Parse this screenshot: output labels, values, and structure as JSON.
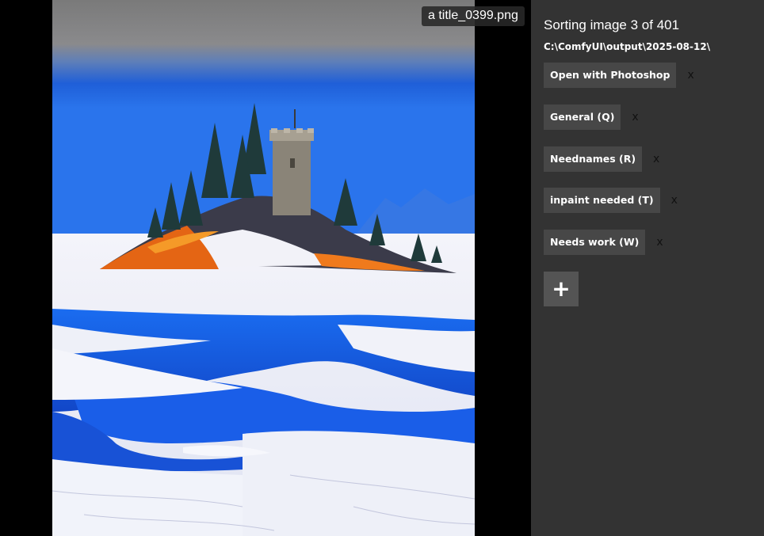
{
  "image": {
    "filename": "a title_0399.png"
  },
  "panel": {
    "title": "Sorting image 3 of 401",
    "path": "C:\\ComfyUI\\output\\2025-08-12\\"
  },
  "actions": [
    {
      "label": "Open with Photoshop",
      "remove": "x"
    },
    {
      "label": "General (Q)",
      "remove": "x"
    },
    {
      "label": "Neednames (R)",
      "remove": "x"
    },
    {
      "label": "inpaint needed (T)",
      "remove": "x"
    },
    {
      "label": "Needs work (W)",
      "remove": "x"
    }
  ],
  "add_button": {
    "label": "+"
  }
}
